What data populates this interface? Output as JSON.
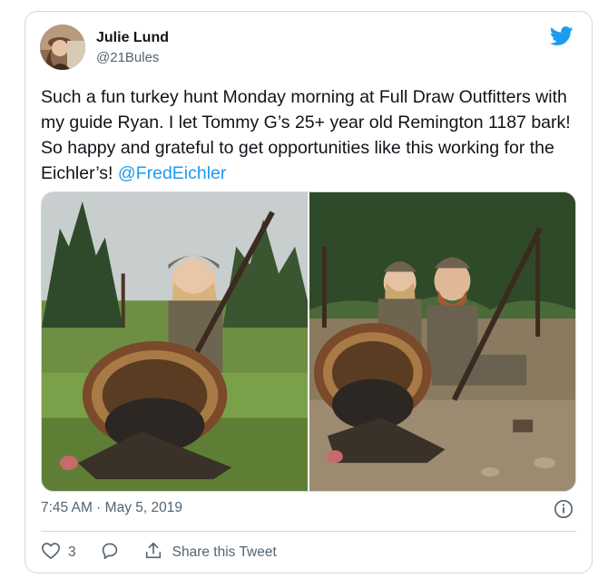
{
  "user": {
    "name": "Julie Lund",
    "handle": "@21Bules"
  },
  "tweet": {
    "text": "Such a fun turkey hunt Monday morning at Full Draw Outfitters with my guide Ryan. I let Tommy G’s 25+ year old Remington 1187 bark! So happy and grateful to get opportunities like this working for the Eichler’s! ",
    "mention": "@FredEichler",
    "time": "7:45 AM",
    "separator": " · ",
    "date": "May 5, 2019"
  },
  "actions": {
    "like_count": "3",
    "share_label": "Share this Tweet"
  },
  "colors": {
    "accent": "#1d9bf0",
    "secondary_text": "#536471",
    "border": "#cfd9de"
  },
  "icons": {
    "brand": "twitter-bird-icon",
    "info": "info-icon",
    "like": "heart-icon",
    "reply": "speech-bubble-icon",
    "share": "share-icon"
  }
}
